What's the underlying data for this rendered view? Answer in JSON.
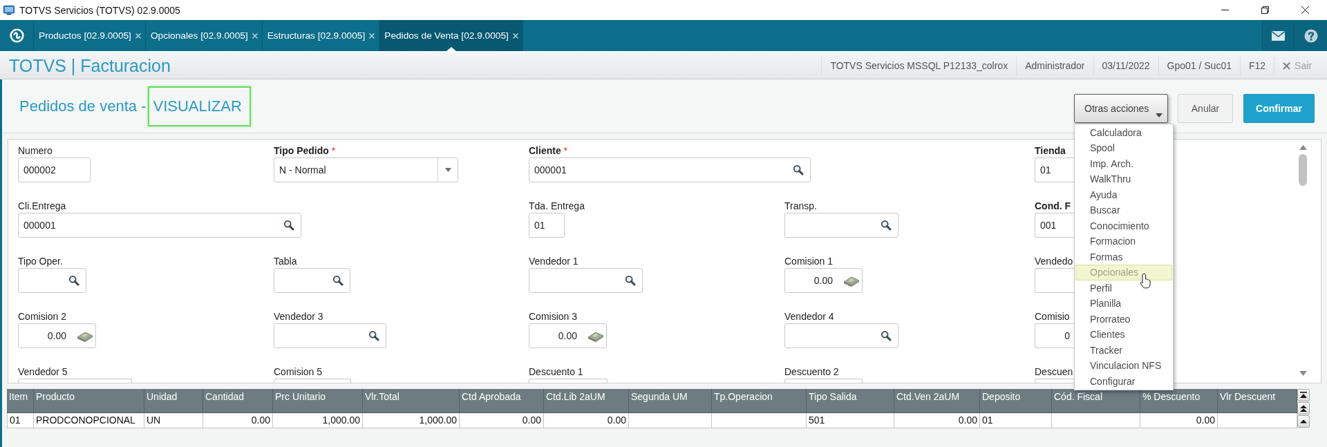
{
  "window": {
    "title": "TOTVS Servicios (TOTVS) 02.9.0005"
  },
  "tabs": [
    {
      "label": "Productos [02.9.0005]",
      "selected": false
    },
    {
      "label": "Opcionales [02.9.0005]",
      "selected": false
    },
    {
      "label": "Estructuras [02.9.0005]",
      "selected": false
    },
    {
      "label": "Pedidos de Venta [02.9.0005]",
      "selected": true
    }
  ],
  "header": {
    "title": "TOTVS | Facturacion",
    "info": [
      "TOTVS Servicios MSSQL P12133_colrox",
      "Administrador",
      "03/11/2022",
      "Gpo01 / Suc01",
      "F12"
    ],
    "exit": "Sair"
  },
  "page": {
    "title": "Pedidos de venta -",
    "mode": "VISUALIZAR",
    "mode_highlighted": true
  },
  "actions": [
    {
      "label": "Otras acciones",
      "kind": "menu",
      "expanded": true,
      "items": [
        {
          "label": "Calculadora",
          "highlighted": false
        },
        {
          "label": "Spool",
          "highlighted": false
        },
        {
          "label": "Imp. Arch.",
          "highlighted": false
        },
        {
          "label": "WalkThru",
          "highlighted": false
        },
        {
          "label": "Ayuda",
          "highlighted": false
        },
        {
          "label": "Buscar",
          "highlighted": false
        },
        {
          "label": "Conocimiento",
          "highlighted": false
        },
        {
          "label": "Formacion",
          "highlighted": false
        },
        {
          "label": "Formas",
          "highlighted": false
        },
        {
          "label": "Opcionales",
          "highlighted": true
        },
        {
          "label": "Perfil",
          "highlighted": false
        },
        {
          "label": "Planilla",
          "highlighted": false
        },
        {
          "label": "Prorrateo",
          "highlighted": false
        },
        {
          "label": "Clientes",
          "highlighted": false
        },
        {
          "label": "Tracker",
          "highlighted": false
        },
        {
          "label": "Vinculacion NFS",
          "highlighted": false
        },
        {
          "label": "Configurar",
          "highlighted": false
        }
      ]
    },
    {
      "label": "Anular",
      "kind": "secondary"
    },
    {
      "label": "Confirmar",
      "kind": "primary"
    }
  ],
  "form": {
    "rows": [
      [
        {
          "label": "Numero",
          "required": false,
          "kind": "text",
          "value": "000002"
        },
        {
          "label": "Tipo Pedido",
          "required": true,
          "mark": "*",
          "kind": "select",
          "value": "N - Normal"
        },
        {
          "label": "Cliente",
          "required": true,
          "mark": "*",
          "kind": "lookup",
          "value": "000001"
        },
        null,
        {
          "label": "Tienda",
          "required": true,
          "kind": "text",
          "value": "01"
        }
      ],
      [
        {
          "label": "Cli.Entrega",
          "required": false,
          "kind": "lookup",
          "value": "000001"
        },
        null,
        {
          "label": "Tda. Entrega",
          "required": false,
          "kind": "text",
          "value": "01"
        },
        {
          "label": "Transp.",
          "required": false,
          "kind": "lookup"
        },
        {
          "label": "Cond. F",
          "required": true,
          "kind": "text",
          "value": "001"
        }
      ],
      [
        {
          "label": "Tipo Oper.",
          "required": false,
          "kind": "lookup"
        },
        {
          "label": "Tabla",
          "required": false,
          "kind": "lookup"
        },
        {
          "label": "Vendedor 1",
          "required": false,
          "kind": "lookup"
        },
        {
          "label": "Comision 1",
          "required": false,
          "kind": "money",
          "value": "0.00"
        },
        {
          "label": "Vendedo",
          "required": false,
          "kind": "text"
        }
      ],
      [
        {
          "label": "Comision 2",
          "required": false,
          "kind": "money",
          "value": "0.00"
        },
        {
          "label": "Vendedor 3",
          "required": false,
          "kind": "lookup"
        },
        {
          "label": "Comision 3",
          "required": false,
          "kind": "money",
          "value": "0.00"
        },
        {
          "label": "Vendedor 4",
          "required": false,
          "kind": "lookup"
        },
        {
          "label": "Comisio",
          "required": false,
          "kind": "number",
          "value": "0"
        }
      ],
      [
        {
          "label": "Vendedor 5",
          "required": false,
          "kind": "text"
        },
        {
          "label": "Comision 5",
          "required": false,
          "kind": "text"
        },
        {
          "label": "Descuento 1",
          "required": false,
          "kind": "text"
        },
        {
          "label": "Descuento 2",
          "required": false,
          "kind": "text"
        },
        {
          "label": "Descuen",
          "required": false,
          "kind": "text"
        }
      ]
    ]
  },
  "grid": {
    "columns": [
      {
        "label": "Item",
        "kind": "text"
      },
      {
        "label": "Producto",
        "kind": "text"
      },
      {
        "label": "Unidad",
        "kind": "text"
      },
      {
        "label": "Cantidad",
        "kind": "number"
      },
      {
        "label": "Prc Unitario",
        "kind": "number"
      },
      {
        "label": "Vlr.Total",
        "kind": "number"
      },
      {
        "label": "Ctd Aprobada",
        "kind": "number"
      },
      {
        "label": "Ctd.Lib 2aUM",
        "kind": "number"
      },
      {
        "label": "Segunda UM",
        "kind": "text"
      },
      {
        "label": "Tp.Operacion",
        "kind": "text"
      },
      {
        "label": "Tipo Salida",
        "kind": "text"
      },
      {
        "label": "Ctd.Ven 2aUM",
        "kind": "number"
      },
      {
        "label": "Deposito",
        "kind": "text"
      },
      {
        "label": "Cód. Fiscal",
        "kind": "text"
      },
      {
        "label": "% Descuento",
        "kind": "number"
      },
      {
        "label": "Vlr Descuent",
        "kind": "number"
      }
    ],
    "rows": [
      [
        "01",
        "PRODCONOPCIONAL",
        "UN",
        "0.00",
        "1,000.00",
        "1,000.00",
        "0.00",
        "0.00",
        null,
        null,
        "501",
        "0.00",
        "01",
        null,
        "0.00",
        null
      ]
    ]
  }
}
